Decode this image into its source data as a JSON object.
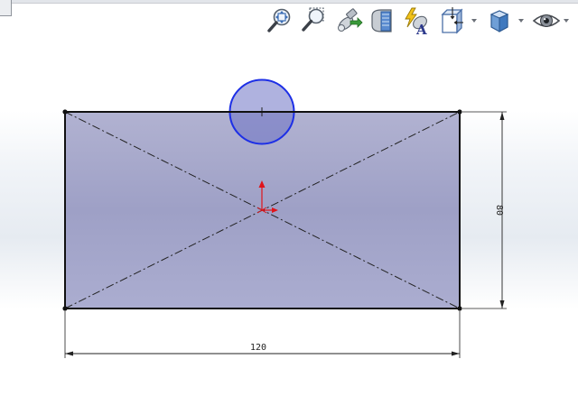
{
  "toolbar": {
    "buttons": [
      {
        "name": "zoom-to-fit-icon"
      },
      {
        "name": "zoom-to-area-icon"
      },
      {
        "name": "previous-view-icon"
      },
      {
        "name": "section-view-icon"
      },
      {
        "name": "dynamic-annotation-view-icon"
      },
      {
        "name": "view-orientation-icon",
        "has_dropdown": true
      },
      {
        "name": "display-style-icon",
        "has_dropdown": true
      },
      {
        "name": "hide-show-items-icon",
        "has_dropdown": true
      }
    ]
  },
  "sketch": {
    "fill_color": "#a7a9cc",
    "line_color": "#111111",
    "circle_color": "#1d2fe6",
    "origin_color": "#e0141b"
  },
  "dimensions": {
    "width_label": "120",
    "height_label": "80"
  }
}
